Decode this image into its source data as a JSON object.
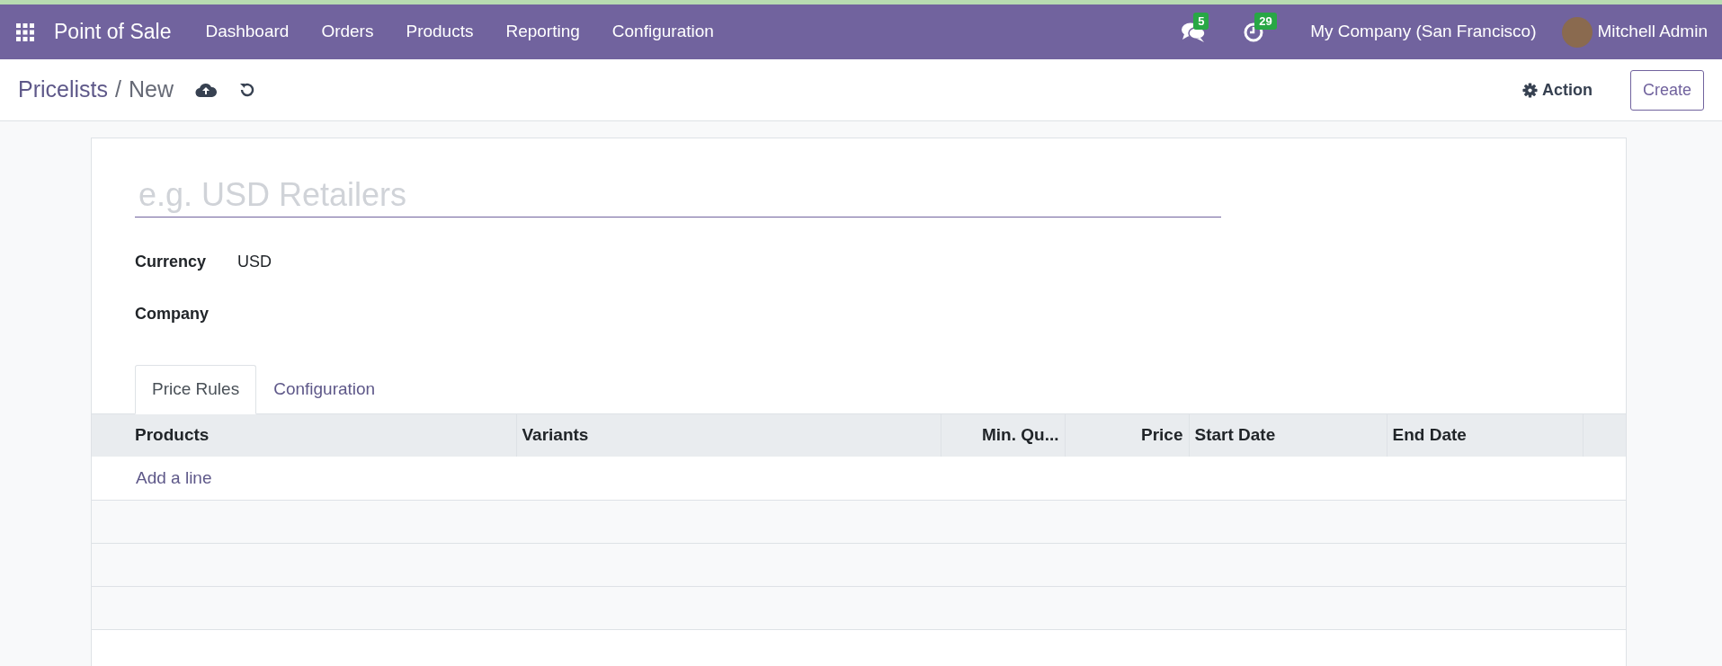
{
  "navbar": {
    "app_title": "Point of Sale",
    "menu": [
      "Dashboard",
      "Orders",
      "Products",
      "Reporting",
      "Configuration"
    ],
    "messages_count": "5",
    "activities_count": "29",
    "company": "My Company (San Francisco)",
    "user": "Mitchell Admin"
  },
  "breadcrumb": {
    "parent": "Pricelists",
    "separator": "/",
    "current": "New"
  },
  "actions": {
    "action": "Action",
    "create": "Create"
  },
  "form": {
    "name_placeholder": "e.g. USD Retailers",
    "fields": [
      {
        "label": "Currency",
        "value": "USD"
      },
      {
        "label": "Company"
      }
    ]
  },
  "tabs": [
    {
      "label": "Price Rules",
      "selected": true
    },
    {
      "label": "Configuration",
      "selected": false
    }
  ],
  "table": {
    "columns": [
      {
        "label": "Products",
        "kind": "text"
      },
      {
        "label": "Variants",
        "kind": "text"
      },
      {
        "label": "Min. Qu...",
        "kind": "number"
      },
      {
        "label": "Price",
        "kind": "number"
      },
      {
        "label": "Start Date",
        "kind": "date"
      },
      {
        "label": "End Date",
        "kind": "date"
      }
    ],
    "add_line": "Add a line"
  }
}
